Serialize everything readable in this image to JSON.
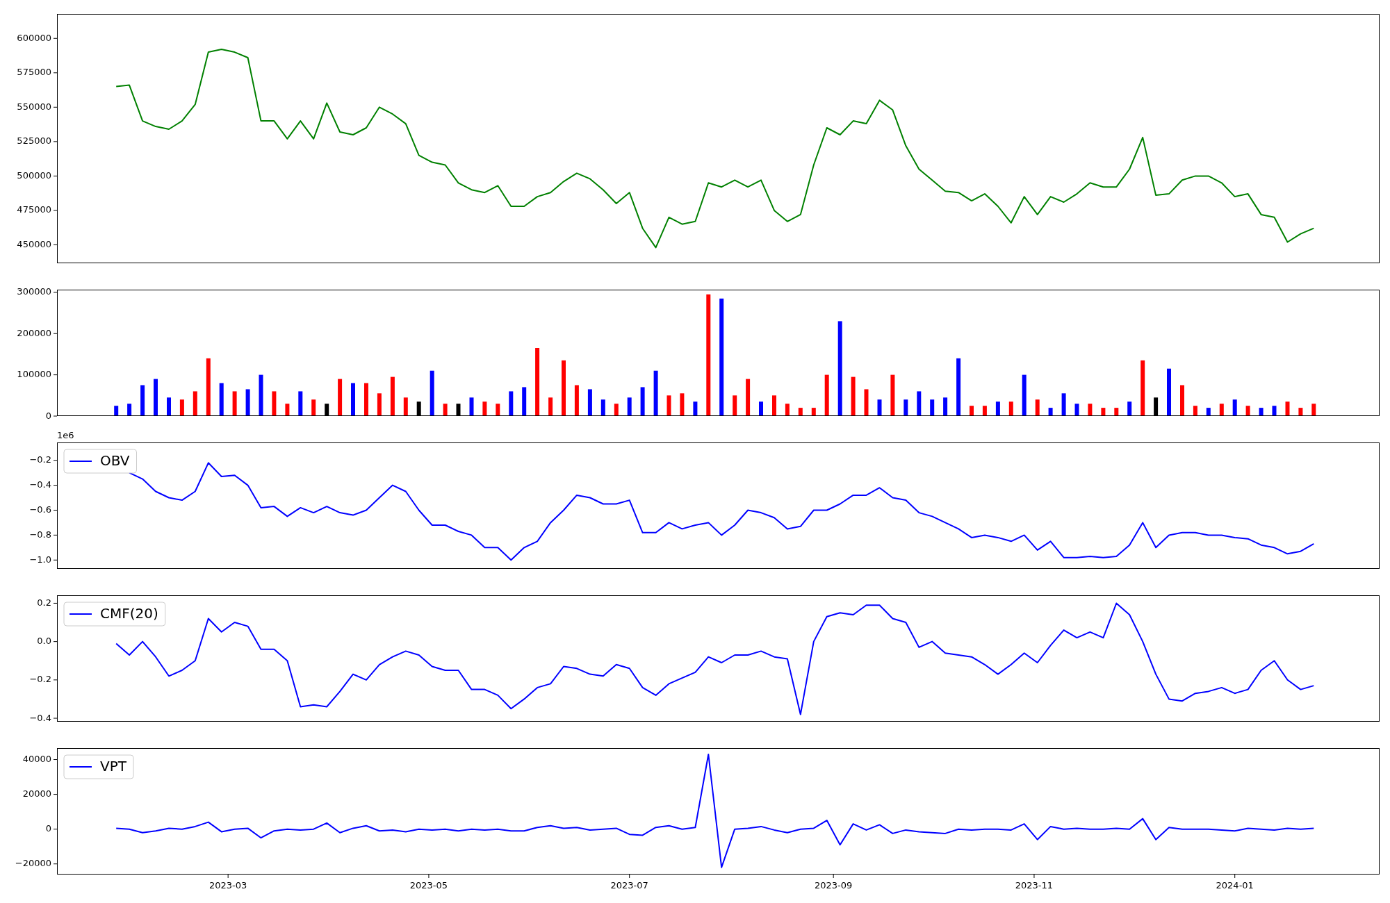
{
  "panels": [
    {
      "chart_data": {
        "type": "line",
        "x": [
          "2023-01-26",
          "2023-01-30",
          "2023-02-03",
          "2023-02-07",
          "2023-02-11",
          "2023-02-15",
          "2023-02-19",
          "2023-02-23",
          "2023-02-27",
          "2023-03-03",
          "2023-03-07",
          "2023-03-11",
          "2023-03-15",
          "2023-03-19",
          "2023-03-23",
          "2023-03-27",
          "2023-03-31",
          "2023-04-04",
          "2023-04-08",
          "2023-04-12",
          "2023-04-16",
          "2023-04-20",
          "2023-04-24",
          "2023-04-28",
          "2023-05-02",
          "2023-05-06",
          "2023-05-10",
          "2023-05-14",
          "2023-05-18",
          "2023-05-22",
          "2023-05-26",
          "2023-05-30",
          "2023-06-03",
          "2023-06-07",
          "2023-06-11",
          "2023-06-15",
          "2023-06-19",
          "2023-06-23",
          "2023-06-27",
          "2023-07-01",
          "2023-07-05",
          "2023-07-09",
          "2023-07-13",
          "2023-07-17",
          "2023-07-21",
          "2023-07-25",
          "2023-07-29",
          "2023-08-02",
          "2023-08-06",
          "2023-08-10",
          "2023-08-14",
          "2023-08-18",
          "2023-08-22",
          "2023-08-26",
          "2023-08-30",
          "2023-09-03",
          "2023-09-07",
          "2023-09-11",
          "2023-09-15",
          "2023-09-19",
          "2023-09-23",
          "2023-09-27",
          "2023-10-01",
          "2023-10-05",
          "2023-10-09",
          "2023-10-13",
          "2023-10-17",
          "2023-10-21",
          "2023-10-25",
          "2023-10-29",
          "2023-11-02",
          "2023-11-06",
          "2023-11-10",
          "2023-11-14",
          "2023-11-18",
          "2023-11-22",
          "2023-11-26",
          "2023-11-30",
          "2023-12-04",
          "2023-12-08",
          "2023-12-12",
          "2023-12-16",
          "2023-12-20",
          "2023-12-24",
          "2023-12-28",
          "2024-01-01",
          "2024-01-05",
          "2024-01-09",
          "2024-01-13",
          "2024-01-17",
          "2024-01-21",
          "2024-01-25"
        ],
        "series": [
          {
            "color": "#008000",
            "values": [
              565000,
              566000,
              540000,
              536000,
              534000,
              540000,
              552000,
              590000,
              592000,
              590000,
              586000,
              540000,
              540000,
              527000,
              540000,
              527000,
              553000,
              532000,
              530000,
              535000,
              550000,
              545000,
              538000,
              515000,
              510000,
              508000,
              495000,
              490000,
              488000,
              493000,
              478000,
              478000,
              485000,
              488000,
              496000,
              502000,
              498000,
              490000,
              480000,
              488000,
              462000,
              448000,
              470000,
              465000,
              467000,
              495000,
              492000,
              497000,
              492000,
              497000,
              475000,
              467000,
              472000,
              508000,
              535000,
              530000,
              540000,
              538000,
              555000,
              548000,
              522000,
              505000,
              497000,
              489000,
              488000,
              482000,
              487000,
              478000,
              466000,
              485000,
              472000,
              485000,
              481000,
              487000,
              495000,
              492000,
              492000,
              505000,
              528000,
              486000,
              487000,
              497000,
              500000,
              500000,
              495000,
              485000,
              487000,
              472000,
              470000,
              452000,
              458000,
              462000
            ]
          }
        ],
        "xlim": [
          "2023-01-08",
          "2024-02-14"
        ],
        "ylim": [
          436600,
          617800
        ],
        "yticks": [
          450000,
          475000,
          500000,
          525000,
          550000,
          575000,
          600000
        ]
      }
    },
    {
      "chart_data": {
        "type": "bar",
        "x": [
          "2023-01-26",
          "2023-01-30",
          "2023-02-03",
          "2023-02-07",
          "2023-02-11",
          "2023-02-15",
          "2023-02-19",
          "2023-02-23",
          "2023-02-27",
          "2023-03-03",
          "2023-03-07",
          "2023-03-11",
          "2023-03-15",
          "2023-03-19",
          "2023-03-23",
          "2023-03-27",
          "2023-03-31",
          "2023-04-04",
          "2023-04-08",
          "2023-04-12",
          "2023-04-16",
          "2023-04-20",
          "2023-04-24",
          "2023-04-28",
          "2023-05-02",
          "2023-05-06",
          "2023-05-10",
          "2023-05-14",
          "2023-05-18",
          "2023-05-22",
          "2023-05-26",
          "2023-05-30",
          "2023-06-03",
          "2023-06-07",
          "2023-06-11",
          "2023-06-15",
          "2023-06-19",
          "2023-06-23",
          "2023-06-27",
          "2023-07-01",
          "2023-07-05",
          "2023-07-09",
          "2023-07-13",
          "2023-07-17",
          "2023-07-21",
          "2023-07-25",
          "2023-07-29",
          "2023-08-02",
          "2023-08-06",
          "2023-08-10",
          "2023-08-14",
          "2023-08-18",
          "2023-08-22",
          "2023-08-26",
          "2023-08-30",
          "2023-09-03",
          "2023-09-07",
          "2023-09-11",
          "2023-09-15",
          "2023-09-19",
          "2023-09-23",
          "2023-09-27",
          "2023-10-01",
          "2023-10-05",
          "2023-10-09",
          "2023-10-13",
          "2023-10-17",
          "2023-10-21",
          "2023-10-25",
          "2023-10-29",
          "2023-11-02",
          "2023-11-06",
          "2023-11-10",
          "2023-11-14",
          "2023-11-18",
          "2023-11-22",
          "2023-11-26",
          "2023-11-30",
          "2023-12-04",
          "2023-12-08",
          "2023-12-12",
          "2023-12-16",
          "2023-12-20",
          "2023-12-24",
          "2023-12-28",
          "2024-01-01",
          "2024-01-05",
          "2024-01-09",
          "2024-01-13",
          "2024-01-17",
          "2024-01-21",
          "2024-01-25"
        ],
        "series": [
          {
            "color": "#ff0000",
            "values": [
              null,
              null,
              null,
              null,
              null,
              40000,
              60000,
              140000,
              null,
              60000,
              null,
              null,
              60000,
              30000,
              null,
              40000,
              null,
              90000,
              null,
              80000,
              55000,
              95000,
              45000,
              null,
              null,
              30000,
              null,
              null,
              35000,
              30000,
              null,
              null,
              165000,
              45000,
              135000,
              75000,
              null,
              null,
              30000,
              null,
              null,
              null,
              50000,
              55000,
              null,
              295000,
              null,
              50000,
              90000,
              null,
              50000,
              30000,
              20000,
              20000,
              100000,
              null,
              95000,
              65000,
              null,
              100000,
              null,
              null,
              null,
              null,
              null,
              25000,
              25000,
              null,
              35000,
              null,
              40000,
              null,
              null,
              null,
              30000,
              20000,
              20000,
              null,
              135000,
              null,
              null,
              75000,
              25000,
              null,
              30000,
              null,
              25000,
              null,
              null,
              35000,
              20000,
              30000
            ]
          },
          {
            "color": "#0000ff",
            "values": [
              25000,
              30000,
              75000,
              90000,
              45000,
              null,
              null,
              null,
              80000,
              null,
              65000,
              100000,
              null,
              null,
              60000,
              null,
              null,
              null,
              80000,
              null,
              null,
              null,
              null,
              null,
              110000,
              null,
              null,
              45000,
              null,
              null,
              60000,
              70000,
              null,
              null,
              null,
              null,
              65000,
              40000,
              null,
              45000,
              70000,
              110000,
              null,
              null,
              35000,
              null,
              285000,
              null,
              null,
              35000,
              null,
              null,
              null,
              null,
              null,
              230000,
              null,
              null,
              40000,
              null,
              40000,
              60000,
              40000,
              45000,
              140000,
              null,
              null,
              35000,
              null,
              100000,
              null,
              20000,
              55000,
              30000,
              null,
              null,
              null,
              35000,
              null,
              null,
              115000,
              null,
              null,
              20000,
              null,
              40000,
              null,
              20000,
              25000,
              null,
              null,
              null
            ]
          },
          {
            "color": "#000000",
            "values": [
              null,
              null,
              null,
              null,
              null,
              null,
              null,
              null,
              null,
              null,
              null,
              null,
              null,
              null,
              null,
              null,
              30000,
              null,
              null,
              null,
              null,
              null,
              null,
              35000,
              null,
              null,
              30000,
              null,
              null,
              null,
              null,
              null,
              null,
              null,
              null,
              null,
              null,
              null,
              null,
              null,
              null,
              null,
              null,
              null,
              null,
              null,
              null,
              null,
              null,
              null,
              null,
              null,
              null,
              null,
              null,
              null,
              null,
              null,
              null,
              null,
              null,
              null,
              null,
              null,
              null,
              null,
              null,
              null,
              null,
              null,
              null,
              null,
              null,
              null,
              null,
              null,
              null,
              null,
              null,
              45000,
              null,
              null,
              null,
              null,
              null,
              null,
              null,
              null,
              null,
              null,
              null,
              null
            ]
          }
        ],
        "xlim": [
          "2023-01-08",
          "2024-02-14"
        ],
        "ylim": [
          0,
          306500
        ],
        "yticks": [
          0,
          100000,
          200000,
          300000
        ]
      }
    },
    {
      "axis_offset_text": "1e6",
      "chart_data": {
        "type": "line",
        "x": [
          "2023-01-30",
          "2023-02-03",
          "2023-02-07",
          "2023-02-11",
          "2023-02-15",
          "2023-02-19",
          "2023-02-23",
          "2023-02-27",
          "2023-03-03",
          "2023-03-07",
          "2023-03-11",
          "2023-03-15",
          "2023-03-19",
          "2023-03-23",
          "2023-03-27",
          "2023-03-31",
          "2023-04-04",
          "2023-04-08",
          "2023-04-12",
          "2023-04-16",
          "2023-04-20",
          "2023-04-24",
          "2023-04-28",
          "2023-05-02",
          "2023-05-06",
          "2023-05-10",
          "2023-05-14",
          "2023-05-18",
          "2023-05-22",
          "2023-05-26",
          "2023-05-30",
          "2023-06-03",
          "2023-06-07",
          "2023-06-11",
          "2023-06-15",
          "2023-06-19",
          "2023-06-23",
          "2023-06-27",
          "2023-07-01",
          "2023-07-05",
          "2023-07-09",
          "2023-07-13",
          "2023-07-17",
          "2023-07-21",
          "2023-07-25",
          "2023-07-29",
          "2023-08-02",
          "2023-08-06",
          "2023-08-10",
          "2023-08-14",
          "2023-08-18",
          "2023-08-22",
          "2023-08-26",
          "2023-08-30",
          "2023-09-03",
          "2023-09-07",
          "2023-09-11",
          "2023-09-15",
          "2023-09-19",
          "2023-09-23",
          "2023-09-27",
          "2023-10-01",
          "2023-10-05",
          "2023-10-09",
          "2023-10-13",
          "2023-10-17",
          "2023-10-21",
          "2023-10-25",
          "2023-10-29",
          "2023-11-02",
          "2023-11-06",
          "2023-11-10",
          "2023-11-14",
          "2023-11-18",
          "2023-11-22",
          "2023-11-26",
          "2023-11-30",
          "2023-12-04",
          "2023-12-08",
          "2023-12-12",
          "2023-12-16",
          "2023-12-20",
          "2023-12-24",
          "2023-12-28",
          "2024-01-01",
          "2024-01-05",
          "2024-01-09",
          "2024-01-13",
          "2024-01-17",
          "2024-01-21",
          "2024-01-25"
        ],
        "series": [
          {
            "name": "OBV",
            "color": "#0000ff",
            "values": [
              -0.3,
              -0.35,
              -0.45,
              -0.5,
              -0.52,
              -0.45,
              -0.22,
              -0.33,
              -0.32,
              -0.4,
              -0.58,
              -0.57,
              -0.65,
              -0.58,
              -0.62,
              -0.57,
              -0.62,
              -0.64,
              -0.6,
              -0.5,
              -0.4,
              -0.45,
              -0.6,
              -0.72,
              -0.72,
              -0.77,
              -0.8,
              -0.9,
              -0.9,
              -1.0,
              -0.9,
              -0.85,
              -0.7,
              -0.6,
              -0.48,
              -0.5,
              -0.55,
              -0.55,
              -0.52,
              -0.78,
              -0.78,
              -0.7,
              -0.75,
              -0.72,
              -0.7,
              -0.8,
              -0.72,
              -0.6,
              -0.62,
              -0.66,
              -0.75,
              -0.73,
              -0.6,
              -0.6,
              -0.55,
              -0.48,
              -0.48,
              -0.42,
              -0.5,
              -0.52,
              -0.62,
              -0.65,
              -0.7,
              -0.75,
              -0.82,
              -0.8,
              -0.82,
              -0.85,
              -0.8,
              -0.92,
              -0.85,
              -0.98,
              -0.98,
              -0.97,
              -0.98,
              -0.97,
              -0.88,
              -0.7,
              -0.9,
              -0.8,
              -0.78,
              -0.78,
              -0.8,
              -0.8,
              -0.82,
              -0.83,
              -0.88,
              -0.9,
              -0.95,
              -0.93,
              -0.87
            ]
          }
        ],
        "xlim": [
          "2023-01-08",
          "2024-02-14"
        ],
        "ylim": [
          -1.071,
          -0.057
        ],
        "yticks": [
          {
            "value": -1.0,
            "label": "−1.0"
          },
          {
            "value": -0.8,
            "label": "−0.8"
          },
          {
            "value": -0.6,
            "label": "−0.6"
          },
          {
            "value": -0.4,
            "label": "−0.4"
          },
          {
            "value": -0.2,
            "label": "−0.2"
          }
        ]
      }
    },
    {
      "chart_data": {
        "type": "line",
        "x": [
          "2023-01-26",
          "2023-01-30",
          "2023-02-03",
          "2023-02-07",
          "2023-02-11",
          "2023-02-15",
          "2023-02-19",
          "2023-02-23",
          "2023-02-27",
          "2023-03-03",
          "2023-03-07",
          "2023-03-11",
          "2023-03-15",
          "2023-03-19",
          "2023-03-23",
          "2023-03-27",
          "2023-03-31",
          "2023-04-04",
          "2023-04-08",
          "2023-04-12",
          "2023-04-16",
          "2023-04-20",
          "2023-04-24",
          "2023-04-28",
          "2023-05-02",
          "2023-05-06",
          "2023-05-10",
          "2023-05-14",
          "2023-05-18",
          "2023-05-22",
          "2023-05-26",
          "2023-05-30",
          "2023-06-03",
          "2023-06-07",
          "2023-06-11",
          "2023-06-15",
          "2023-06-19",
          "2023-06-23",
          "2023-06-27",
          "2023-07-01",
          "2023-07-05",
          "2023-07-09",
          "2023-07-13",
          "2023-07-17",
          "2023-07-21",
          "2023-07-25",
          "2023-07-29",
          "2023-08-02",
          "2023-08-06",
          "2023-08-10",
          "2023-08-14",
          "2023-08-18",
          "2023-08-22",
          "2023-08-26",
          "2023-08-30",
          "2023-09-03",
          "2023-09-07",
          "2023-09-11",
          "2023-09-15",
          "2023-09-19",
          "2023-09-23",
          "2023-09-27",
          "2023-10-01",
          "2023-10-05",
          "2023-10-09",
          "2023-10-13",
          "2023-10-17",
          "2023-10-21",
          "2023-10-25",
          "2023-10-29",
          "2023-11-02",
          "2023-11-06",
          "2023-11-10",
          "2023-11-14",
          "2023-11-18",
          "2023-11-22",
          "2023-11-26",
          "2023-11-30",
          "2023-12-04",
          "2023-12-08",
          "2023-12-12",
          "2023-12-16",
          "2023-12-20",
          "2023-12-24",
          "2023-12-28",
          "2024-01-01",
          "2024-01-05",
          "2024-01-09",
          "2024-01-13",
          "2024-01-17",
          "2024-01-21",
          "2024-01-25"
        ],
        "series": [
          {
            "name": "CMF(20)",
            "color": "#0000ff",
            "values": [
              -0.01,
              -0.07,
              0.0,
              -0.08,
              -0.18,
              -0.15,
              -0.1,
              0.12,
              0.05,
              0.1,
              0.08,
              -0.04,
              -0.04,
              -0.1,
              -0.34,
              -0.33,
              -0.34,
              -0.26,
              -0.17,
              -0.2,
              -0.12,
              -0.08,
              -0.05,
              -0.07,
              -0.13,
              -0.15,
              -0.15,
              -0.25,
              -0.25,
              -0.28,
              -0.35,
              -0.3,
              -0.24,
              -0.22,
              -0.13,
              -0.14,
              -0.17,
              -0.18,
              -0.12,
              -0.14,
              -0.24,
              -0.28,
              -0.22,
              -0.19,
              -0.16,
              -0.08,
              -0.11,
              -0.07,
              -0.07,
              -0.05,
              -0.08,
              -0.09,
              -0.38,
              0.0,
              0.13,
              0.15,
              0.14,
              0.19,
              0.19,
              0.12,
              0.1,
              -0.03,
              0.0,
              -0.06,
              -0.07,
              -0.08,
              -0.12,
              -0.17,
              -0.12,
              -0.06,
              -0.11,
              -0.02,
              0.06,
              0.02,
              0.05,
              0.02,
              0.2,
              0.14,
              0.0,
              -0.17,
              -0.3,
              -0.31,
              -0.27,
              -0.26,
              -0.24,
              -0.27,
              -0.25,
              -0.15,
              -0.1,
              -0.2,
              -0.25,
              -0.23
            ]
          }
        ],
        "xlim": [
          "2023-01-08",
          "2024-02-14"
        ],
        "ylim": [
          -0.418,
          0.2415
        ],
        "yticks": [
          {
            "value": -0.4,
            "label": "−0.4"
          },
          {
            "value": -0.2,
            "label": "−0.2"
          },
          {
            "value": 0,
            "label": "0.0"
          },
          {
            "value": 0.2,
            "label": "0.2"
          }
        ]
      }
    },
    {
      "chart_data": {
        "type": "line",
        "x": [
          "2023-01-26",
          "2023-01-30",
          "2023-02-03",
          "2023-02-07",
          "2023-02-11",
          "2023-02-15",
          "2023-02-19",
          "2023-02-23",
          "2023-02-27",
          "2023-03-03",
          "2023-03-07",
          "2023-03-11",
          "2023-03-15",
          "2023-03-19",
          "2023-03-23",
          "2023-03-27",
          "2023-03-31",
          "2023-04-04",
          "2023-04-08",
          "2023-04-12",
          "2023-04-16",
          "2023-04-20",
          "2023-04-24",
          "2023-04-28",
          "2023-05-02",
          "2023-05-06",
          "2023-05-10",
          "2023-05-14",
          "2023-05-18",
          "2023-05-22",
          "2023-05-26",
          "2023-05-30",
          "2023-06-03",
          "2023-06-07",
          "2023-06-11",
          "2023-06-15",
          "2023-06-19",
          "2023-06-23",
          "2023-06-27",
          "2023-07-01",
          "2023-07-05",
          "2023-07-09",
          "2023-07-13",
          "2023-07-17",
          "2023-07-21",
          "2023-07-25",
          "2023-07-29",
          "2023-08-02",
          "2023-08-06",
          "2023-08-10",
          "2023-08-14",
          "2023-08-18",
          "2023-08-22",
          "2023-08-26",
          "2023-08-30",
          "2023-09-03",
          "2023-09-07",
          "2023-09-11",
          "2023-09-15",
          "2023-09-19",
          "2023-09-23",
          "2023-09-27",
          "2023-10-01",
          "2023-10-05",
          "2023-10-09",
          "2023-10-13",
          "2023-10-17",
          "2023-10-21",
          "2023-10-25",
          "2023-10-29",
          "2023-11-02",
          "2023-11-06",
          "2023-11-10",
          "2023-11-14",
          "2023-11-18",
          "2023-11-22",
          "2023-11-26",
          "2023-11-30",
          "2023-12-04",
          "2023-12-08",
          "2023-12-12",
          "2023-12-16",
          "2023-12-20",
          "2023-12-24",
          "2023-12-28",
          "2024-01-01",
          "2024-01-05",
          "2024-01-09",
          "2024-01-13",
          "2024-01-17",
          "2024-01-21",
          "2024-01-25"
        ],
        "series": [
          {
            "name": "VPT",
            "color": "#0000ff",
            "values": [
              500,
              0,
              -2000,
              -1000,
              500,
              0,
              1500,
              4000,
              -1500,
              0,
              500,
              -5000,
              -1000,
              0,
              -500,
              0,
              3500,
              -2000,
              500,
              2000,
              -1000,
              -500,
              -1500,
              0,
              -500,
              0,
              -1000,
              0,
              -500,
              0,
              -1000,
              -1000,
              1000,
              2000,
              500,
              1000,
              -500,
              0,
              500,
              -3000,
              -3500,
              1000,
              2000,
              0,
              1000,
              43000,
              -22000,
              0,
              500,
              1500,
              -500,
              -2000,
              0,
              500,
              5000,
              -9000,
              3000,
              -500,
              2500,
              -2500,
              -500,
              -1500,
              -2000,
              -2500,
              0,
              -500,
              0,
              0,
              -500,
              3000,
              -6000,
              1500,
              0,
              500,
              0,
              0,
              500,
              0,
              6000,
              -6000,
              1000,
              0,
              0,
              0,
              -500,
              -1000,
              500,
              0,
              -500,
              500,
              0,
              500
            ]
          }
        ],
        "xlim": [
          "2023-01-08",
          "2024-02-14"
        ],
        "ylim": [
          -26100,
          46600
        ],
        "yticks": [
          {
            "value": -20000,
            "label": "−20000"
          },
          0,
          20000,
          40000
        ],
        "xticks": [
          {
            "value": "2023-03-01",
            "label": "2023-03"
          },
          {
            "value": "2023-05-01",
            "label": "2023-05"
          },
          {
            "value": "2023-07-01",
            "label": "2023-07"
          },
          {
            "value": "2023-09-01",
            "label": "2023-09"
          },
          {
            "value": "2023-11-01",
            "label": "2023-11"
          },
          {
            "value": "2024-01-01",
            "label": "2024-01"
          }
        ]
      }
    }
  ]
}
